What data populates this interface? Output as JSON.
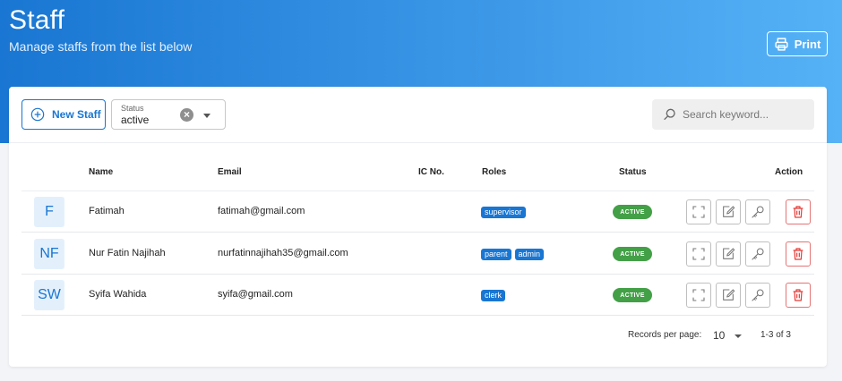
{
  "header": {
    "title": "Staff",
    "subtitle": "Manage staffs from the list below",
    "print_label": "Print"
  },
  "toolbar": {
    "new_label": "New Staff",
    "status_filter": {
      "label": "Status",
      "value": "active"
    },
    "search": {
      "placeholder": "Search keyword..."
    }
  },
  "table": {
    "columns": {
      "name": "Name",
      "email": "Email",
      "ic": "IC No.",
      "roles": "Roles",
      "status": "Status",
      "action": "Action"
    },
    "rows": [
      {
        "initials": "F",
        "name": "Fatimah",
        "email": "fatimah@gmail.com",
        "ic": "",
        "roles": [
          "supervisor"
        ],
        "status": "ACTIVE"
      },
      {
        "initials": "NF",
        "name": "Nur Fatin Najihah",
        "email": "nurfatinnajihah35@gmail.com",
        "ic": "",
        "roles": [
          "parent",
          "admin"
        ],
        "status": "ACTIVE"
      },
      {
        "initials": "SW",
        "name": "Syifa Wahida",
        "email": "syifa@gmail.com",
        "ic": "",
        "roles": [
          "clerk"
        ],
        "status": "ACTIVE"
      }
    ]
  },
  "pagination": {
    "records_label": "Records per page:",
    "records_value": "10",
    "range": "1-3 of 3"
  },
  "icons": {
    "print": "print-icon",
    "new": "plus-circle-icon",
    "clear": "clear-icon",
    "caret": "chevron-down-icon",
    "search": "search-icon",
    "view": "expand-icon",
    "edit": "edit-icon",
    "key": "key-icon",
    "delete": "trash-icon"
  },
  "colors": {
    "primary": "#1976d2",
    "active": "#43a047",
    "danger": "#e53935"
  }
}
